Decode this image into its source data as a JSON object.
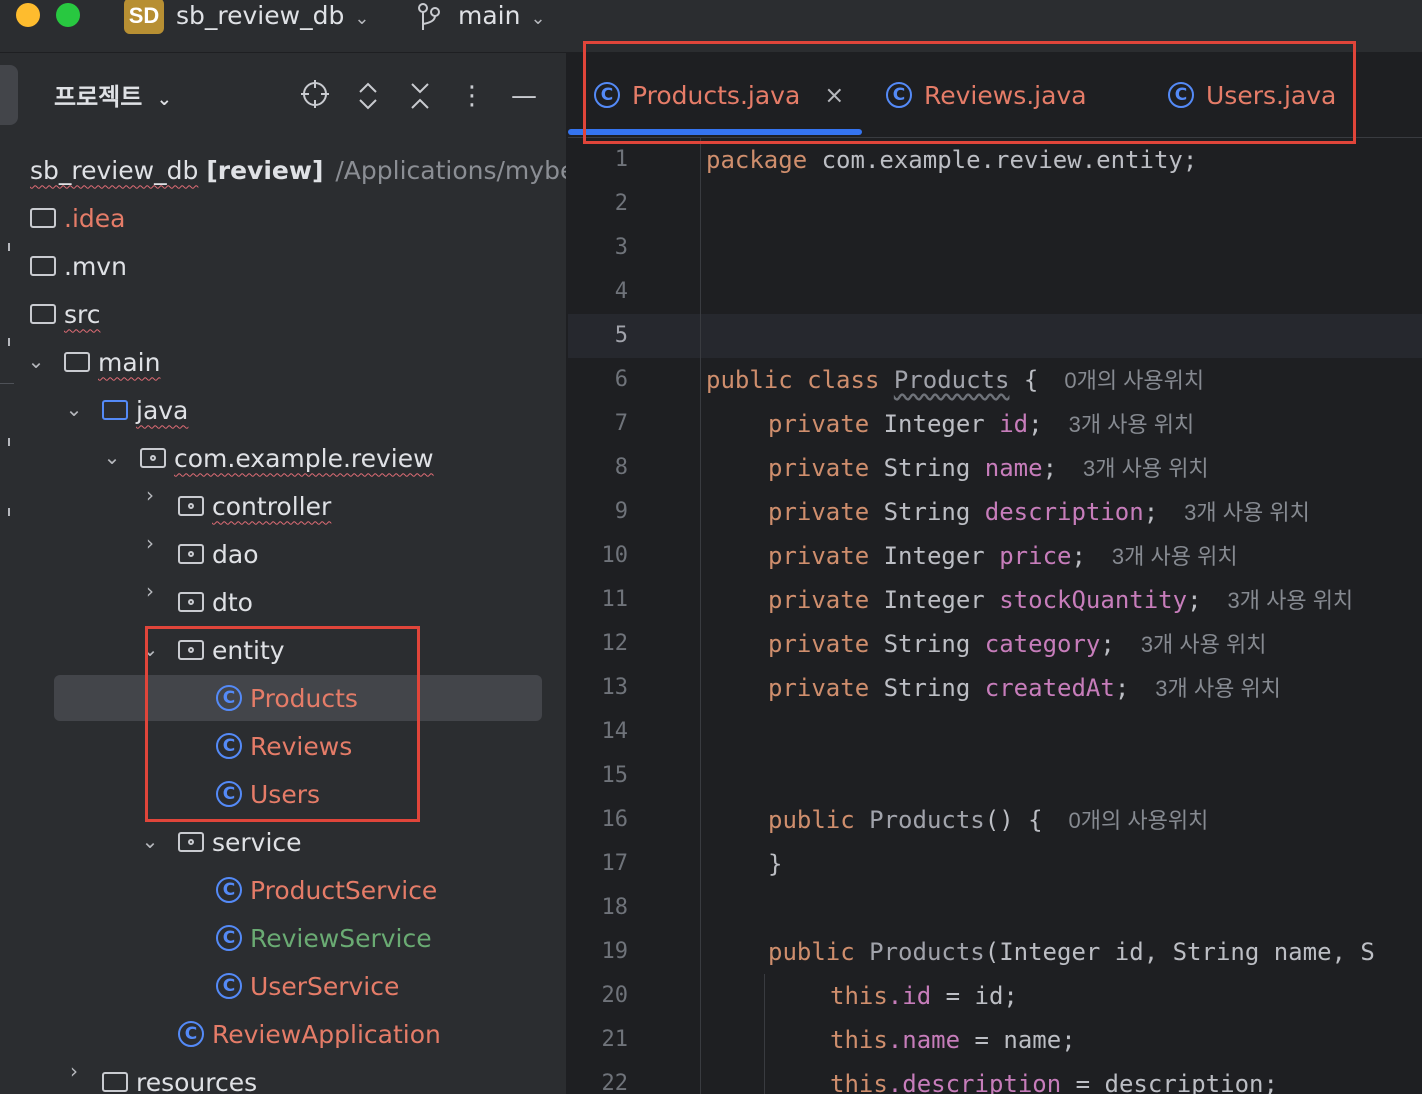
{
  "titlebar": {
    "project_badge": "SD",
    "project_name": "sb_review_db",
    "branch": "main"
  },
  "sidebar": {
    "title": "프로젝트",
    "root": {
      "name": "sb_review_db",
      "module": "[review]",
      "path": "/Applications/mybear"
    },
    "items": {
      "idea": ".idea",
      "mvn": ".mvn",
      "src": "src",
      "main": "main",
      "java": "java",
      "pkg": "com.example.review",
      "controller": "controller",
      "dao": "dao",
      "dto": "dto",
      "entity": "entity",
      "products": "Products",
      "reviews": "Reviews",
      "users": "Users",
      "service": "service",
      "product_service": "ProductService",
      "review_service": "ReviewService",
      "user_service": "UserService",
      "review_application": "ReviewApplication",
      "resources": "resources"
    }
  },
  "tabs": [
    {
      "label": "Products.java",
      "active": true
    },
    {
      "label": "Reviews.java",
      "active": false
    },
    {
      "label": "Users.java",
      "active": false
    }
  ],
  "editor": {
    "line_numbers": [
      "1",
      "2",
      "3",
      "4",
      "5",
      "6",
      "7",
      "8",
      "9",
      "10",
      "11",
      "12",
      "13",
      "14",
      "15",
      "16",
      "17",
      "18",
      "19",
      "20",
      "21",
      "22"
    ],
    "current_line": 5,
    "code": {
      "l1_kw": "package",
      "l1_rest": " com.example.review.entity;",
      "l6_kw": "public class",
      "l6_name": "Products",
      "l6_brace": " {",
      "l6_hint": "0개의 사용위치",
      "fields": [
        {
          "kw": "private",
          "type": "Integer",
          "name": "id",
          "hint": "3개 사용 위치"
        },
        {
          "kw": "private",
          "type": "String",
          "name": "name",
          "hint": "3개 사용 위치"
        },
        {
          "kw": "private",
          "type": "String",
          "name": "description",
          "hint": "3개 사용 위치"
        },
        {
          "kw": "private",
          "type": "Integer",
          "name": "price",
          "hint": "3개 사용 위치"
        },
        {
          "kw": "private",
          "type": "Integer",
          "name": "stockQuantity",
          "hint": "3개 사용 위치"
        },
        {
          "kw": "private",
          "type": "String",
          "name": "category",
          "hint": "3개 사용 위치"
        },
        {
          "kw": "private",
          "type": "String",
          "name": "createdAt",
          "hint": "3개 사용 위치"
        }
      ],
      "l16_kw": "public",
      "l16_name": "Products",
      "l16_rest": "() {",
      "l16_hint": "0개의 사용위치",
      "l17": "}",
      "l19_kw": "public",
      "l19_name": "Products",
      "l19_rest": "(Integer id, String name, S",
      "l20_this": "this",
      "l20_field": ".id",
      "l20_rest": " = id;",
      "l21_this": "this",
      "l21_field": ".name",
      "l21_rest": " = name;",
      "l22_this": "this",
      "l22_field": ".description",
      "l22_rest": " = description;"
    }
  },
  "colors": {
    "annotation_box": "#e0453a",
    "accent": "#3574f0",
    "vcs_modified": "#e57c68",
    "vcs_added": "#6aab73"
  }
}
